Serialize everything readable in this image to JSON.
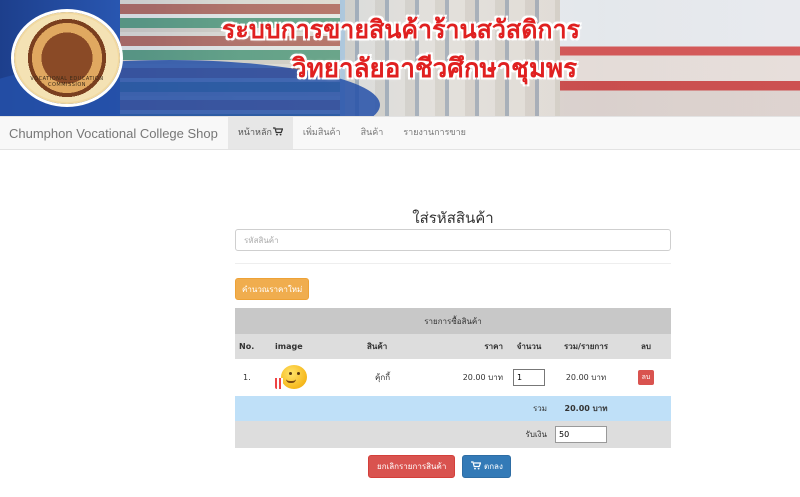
{
  "banner": {
    "title_line1": "ระบบการขายสินค้าร้านสวัสดิการ",
    "title_line2": "วิทยาลัยอาชีวศึกษาชุมพร",
    "logo_text": "VOCATIONAL EDUCATION COMMISSION",
    "logo_icon": "college-emblem"
  },
  "navbar": {
    "brand": "Chumphon Vocational College Shop",
    "items": [
      {
        "label": "หน้าหลัก",
        "icon": "cart-icon"
      },
      {
        "label": "เพิ่มสินค้า"
      },
      {
        "label": "สินค้า"
      },
      {
        "label": "รายงานการขาย"
      }
    ]
  },
  "main": {
    "heading": "ใส่รหัสสินค้า",
    "code_placeholder": "รหัสสินค้า",
    "recalc_label": "คำนวณราคาใหม่",
    "cart": {
      "caption": "รายการซื้อสินค้า",
      "columns": [
        "No.",
        "image",
        "สินค้า",
        "ราคา",
        "จำนวน",
        "รวม/รายการ",
        "ลบ"
      ],
      "rows": [
        {
          "no": "1.",
          "name": "คุ้กกี้",
          "price": "20.00 บาท",
          "qty": "1",
          "subtotal": "20.00 บาท",
          "delete_label": "ลบ"
        }
      ],
      "total_label": "รวม",
      "total_value": "20.00 บาท",
      "pay_label": "รับเงิน",
      "pay_value": "50"
    },
    "cancel_label": "ยกเลิกรายการสินค้า",
    "ok_label": "ตกลง"
  },
  "colors": {
    "warning": "#f0ad4e",
    "danger": "#d9534f",
    "primary": "#337ab7",
    "total_row": "#bfe0f8",
    "banner_red": "#e02020"
  }
}
